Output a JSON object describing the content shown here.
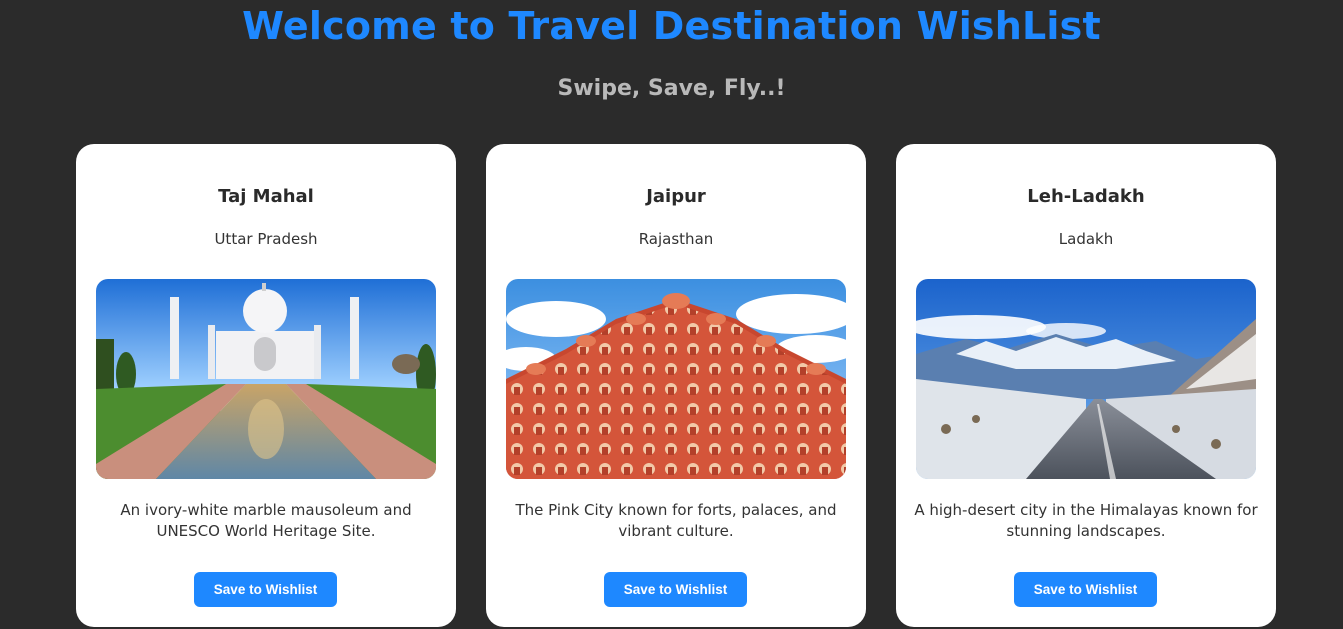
{
  "header": {
    "title": "Welcome to Travel Destination WishList",
    "subtitle": "Swipe, Save, Fly..!"
  },
  "cards": [
    {
      "name": "Taj Mahal",
      "state": "Uttar Pradesh",
      "description": "An ivory-white marble mausoleum and UNESCO World Heritage Site.",
      "button_label": "Save to Wishlist",
      "image_alt": "taj-mahal-photo"
    },
    {
      "name": "Jaipur",
      "state": "Rajasthan",
      "description": "The Pink City known for forts, palaces, and vibrant culture.",
      "button_label": "Save to Wishlist",
      "image_alt": "hawa-mahal-photo"
    },
    {
      "name": "Leh-Ladakh",
      "state": "Ladakh",
      "description": "A high-desert city in the Himalayas known for stunning landscapes.",
      "button_label": "Save to Wishlist",
      "image_alt": "ladakh-road-photo"
    }
  ],
  "colors": {
    "accent": "#1e88ff",
    "background": "#2b2b2b",
    "card": "#ffffff"
  }
}
